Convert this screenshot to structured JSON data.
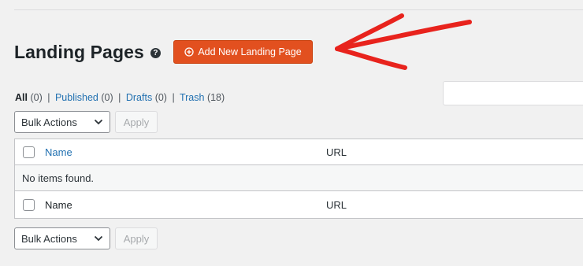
{
  "header": {
    "title": "Landing Pages",
    "help_icon_glyph": "?",
    "add_new_label": "Add New Landing Page",
    "add_new_color": "#e2501f"
  },
  "annotation": {
    "arrow_color": "#e8231d",
    "icon": "hand-drawn-arrow-icon"
  },
  "filters": {
    "all": {
      "label": "All",
      "count": "(0)"
    },
    "published": {
      "label": "Published",
      "count": "(0)"
    },
    "drafts": {
      "label": "Drafts",
      "count": "(0)"
    },
    "trash": {
      "label": "Trash",
      "count": "(18)"
    },
    "separator": "|"
  },
  "search": {
    "placeholder": ""
  },
  "bulk_top": {
    "select_value": "Bulk Actions",
    "apply_label": "Apply"
  },
  "bulk_bottom": {
    "select_value": "Bulk Actions",
    "apply_label": "Apply"
  },
  "table": {
    "columns": [
      "Name",
      "URL"
    ],
    "empty_message": "No items found.",
    "footer_columns": [
      "Name",
      "URL"
    ]
  }
}
